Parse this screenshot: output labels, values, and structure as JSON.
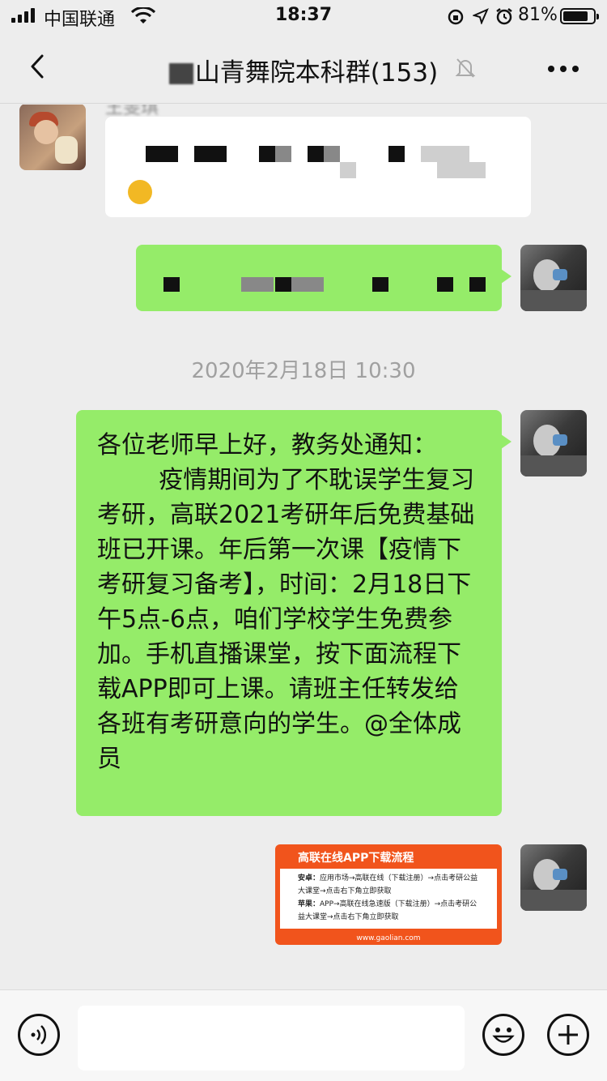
{
  "status_bar": {
    "carrier": "中国联通",
    "time": "18:37",
    "battery": "81%",
    "battery_level": 0.81,
    "icons": [
      "signal-icon",
      "wifi-icon",
      "lock-rotation-icon",
      "location-icon",
      "alarm-icon",
      "battery-icon"
    ]
  },
  "nav": {
    "title": "山青舞院本科群(153)",
    "icons": [
      "back-icon",
      "mute-icon",
      "more-icon"
    ]
  },
  "messages": {
    "sender_name": "王雯琪",
    "timestamp": "2020年2月18日 10:30",
    "notice_text": "各位老师早上好，教务处通知：\n        疫情期间为了不耽误学生复习考研，高联2021考研年后免费基础班已开课。年后第一次课【疫情下考研复习备考】，时间：2月18日下午5点-6点，咱们学校学生免费参加。手机直播课堂，按下面流程下载APP即可上课。请班主任转发给各班有考研意向的学生。@全体成员",
    "image_card": {
      "title": "高联在线APP下载流程",
      "android_label": "安卓：",
      "android_text": "应用市场→高联在线（下载注册）→点击考研公益大课堂→点击右下角立即获取",
      "apple_label": "苹果：",
      "apple_text": "APP→高联在线急速版（下载注册）→点击考研公益大课堂→点击右下角立即获取",
      "url": "www.gaolian.com"
    }
  },
  "input_bar": {
    "placeholder": "",
    "icons": [
      "voice-icon",
      "emoji-icon",
      "add-icon"
    ]
  }
}
